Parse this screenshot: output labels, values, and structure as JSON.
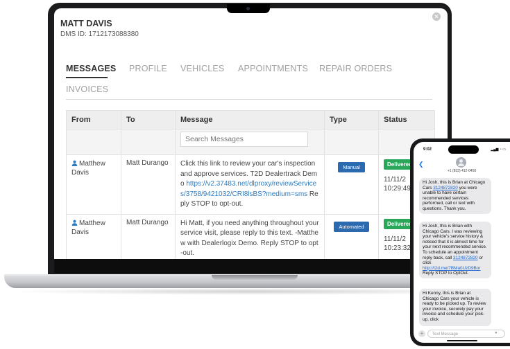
{
  "customer": {
    "name": "MATT DAVIS",
    "dms_label": "DMS ID:",
    "dms_id": "1712173088380"
  },
  "tabs": [
    {
      "label": "MESSAGES",
      "active": true
    },
    {
      "label": "PROFILE",
      "active": false
    },
    {
      "label": "VEHICLES",
      "active": false
    },
    {
      "label": "APPOINTMENTS",
      "active": false
    },
    {
      "label": "REPAIR ORDERS",
      "active": false
    },
    {
      "label": "INVOICES",
      "active": false
    }
  ],
  "table": {
    "headers": {
      "from": "From",
      "to": "To",
      "message": "Message",
      "type": "Type",
      "status": "Status"
    },
    "search_placeholder": "Search Messages",
    "rows": [
      {
        "from": "Matthew Davis",
        "to": "Matt Durango",
        "message_before": "Click this link to review your car's inspection and approve services. T2D Dealertrack Demo ",
        "message_link": "https://v2.37483.net/dlproxy/reviewServices/3758/9421032/CRI8lsBS?medium=sms",
        "message_after": " Reply STOP to opt-out.",
        "type": "Manual",
        "status": "Delivered",
        "date": "11/11/2",
        "time": "10:29:49"
      },
      {
        "from": "Matthew Davis",
        "to": "Matt Durango",
        "message_before": "Hi Matt, if you need anything throughout your service visit, please reply to this text. -Matthew with Dealerlogix Demo. Reply STOP to opt-out.",
        "message_link": "",
        "message_after": "",
        "type": "Automated",
        "status": "Delivered",
        "date": "11/11/2",
        "time": "10:23:32"
      }
    ]
  },
  "phone": {
    "time": "9:02",
    "contact_number": "+1 (833) 412-0450",
    "input_placeholder": "Text Message",
    "messages": [
      {
        "before": "Hi Josh, this is Brian at Chicago Cars ",
        "link": "3124872820",
        "after": " you were unable to have certain recommended services performed, call or text with questions. Thank you."
      },
      {
        "before": "Hi Josh, this is Brian with Chicago Cars. I was reviewing your vehicle's service history & noticed that it is almost time for your next recommended service. To schedule an appointment reply back, call ",
        "link": "3124872820",
        "middle": " or click ",
        "link2": "http://t2d.me/7BMa0UzD9Bor",
        "after": " Reply STOP to OptOut."
      },
      {
        "before": "Hi Kenny, this is Brian at Chicago Cars your vehicle is ready to be picked up. To review your invoice, securely pay your invoice and schedule your pick-up, click"
      }
    ]
  },
  "colors": {
    "link_blue": "#2f7bbf",
    "manual_badge": "#2c6ab0",
    "delivered_green": "#29a65a",
    "imessage_link": "#1a65d6"
  }
}
